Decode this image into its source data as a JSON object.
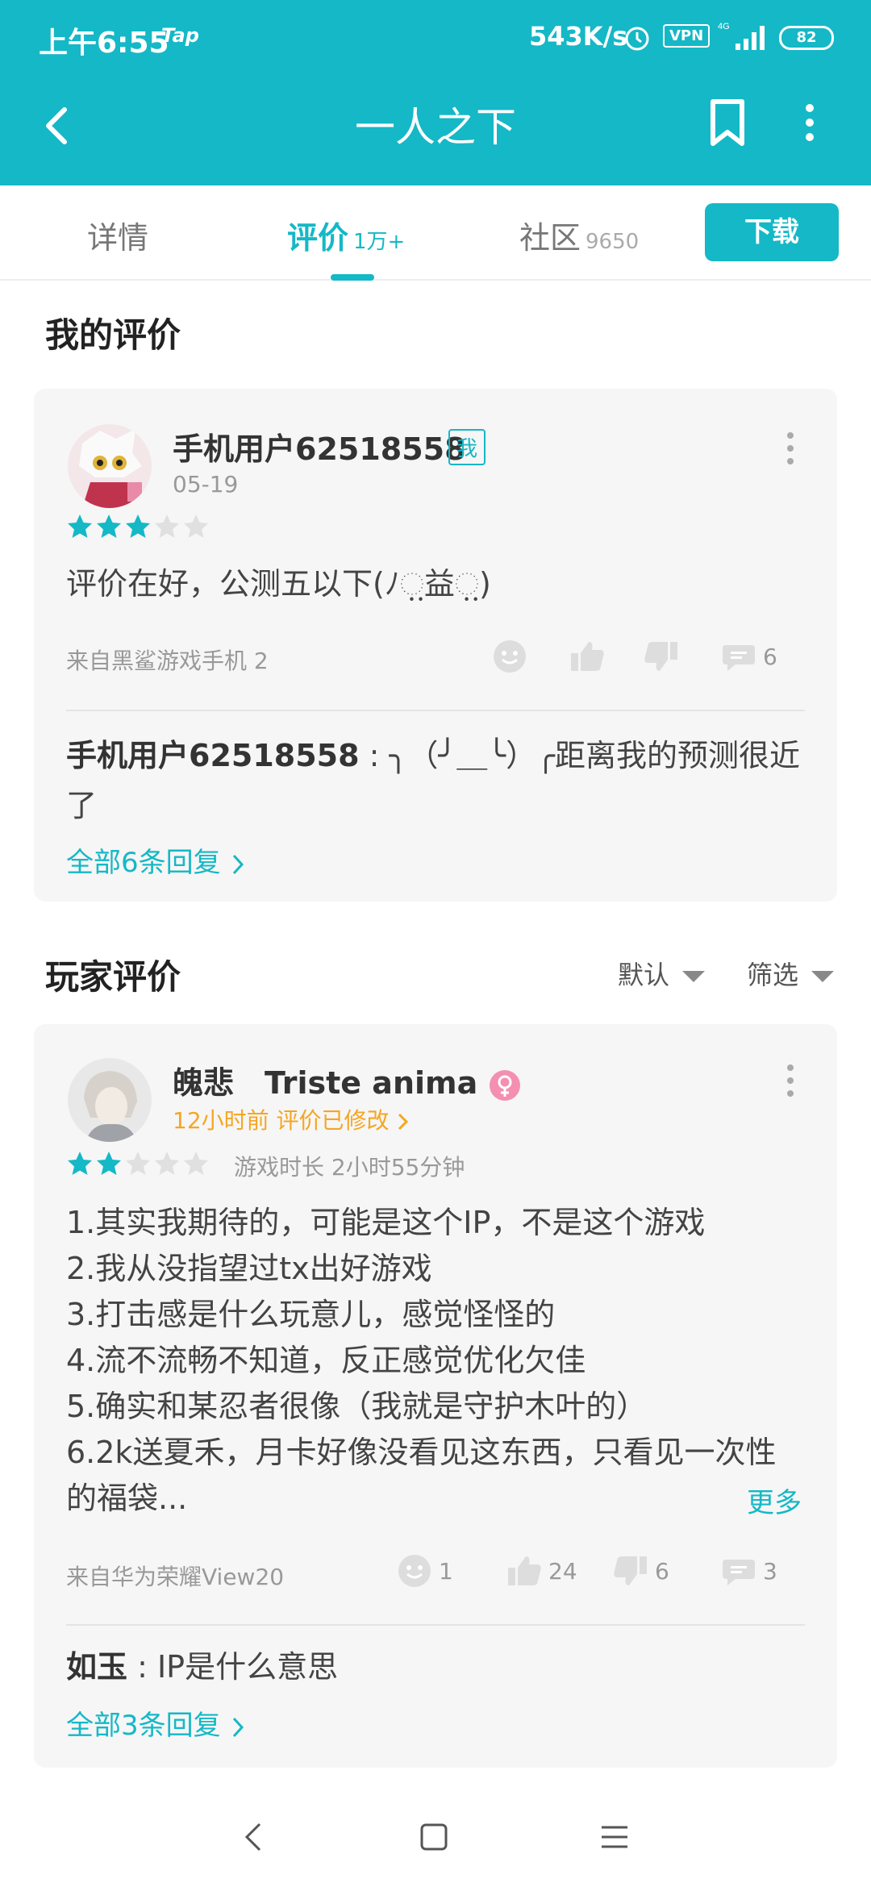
{
  "status_bar": {
    "time": "上午6:55",
    "tap": "Tap",
    "network_speed": "543K/s",
    "vpn": "VPN",
    "signal": "4G",
    "battery": "82"
  },
  "app_bar": {
    "title": "一人之下"
  },
  "tabs": [
    {
      "label": "详情",
      "count": ""
    },
    {
      "label": "评价",
      "count": "1万+"
    },
    {
      "label": "社区",
      "count": "9650"
    }
  ],
  "download_label": "下载",
  "my_review": {
    "section_title": "我的评价",
    "username": "手机用户62518558",
    "badge": "我",
    "date": "05-19",
    "rating": 3,
    "content": "评价在好，公测五以下(ﾉ಼益಼)",
    "device": "来自黑鲨游戏手机 2",
    "reply_count": "6",
    "reply_author": "手机用户62518558",
    "reply_text": " : ╮（╯＿╰）╭距离我的预测很近了",
    "all_replies": "全部6条回复"
  },
  "player_reviews": {
    "section_title": "玩家评价",
    "sort_label": "默认",
    "filter_label": "筛选",
    "review": {
      "username": "魄悲　Triste anima",
      "time": "12小时前 评价已修改",
      "rating": 2,
      "playtime": "游戏时长 2小时55分钟",
      "lines": [
        "1.其实我期待的，可能是这个IP，不是这个游戏",
        "2.我从没指望过tx出好游戏",
        "3.打击感是什么玩意儿，感觉怪怪的",
        "4.流不流畅不知道，反正感觉优化欠佳",
        "5.确实和某忍者很像（我就是守护木叶的）",
        "6.2k送夏禾，月卡好像没看见这东西，只看见一次性",
        "的福袋..."
      ],
      "more_label": "更多",
      "device": "来自华为荣耀View20",
      "emoji_count": "1",
      "like_count": "24",
      "dislike_count": "6",
      "reply_count": "3",
      "reply_author": "如玉",
      "reply_text": " : IP是什么意思",
      "all_replies": "全部3条回复"
    }
  },
  "colors": {
    "accent": "#15b8c6",
    "star_filled": "#15b8c6",
    "star_empty": "#e0e0e0",
    "orange": "#f5a623"
  }
}
